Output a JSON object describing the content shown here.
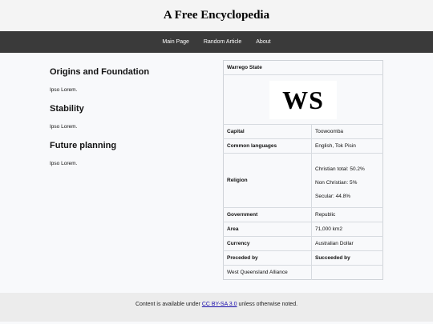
{
  "site": {
    "title": "A Free Encyclopedia"
  },
  "nav": {
    "items": [
      "Main Page",
      "Random Article",
      "About"
    ]
  },
  "article": {
    "sections": [
      {
        "heading": "Origins and Foundation",
        "body": "Ipso Lorem."
      },
      {
        "heading": "Stability",
        "body": "Ipso Lorem."
      },
      {
        "heading": "Future planning",
        "body": "Ipso Lorem."
      }
    ]
  },
  "infobox": {
    "title": "Warrego State",
    "logo_text": "WS",
    "capital_label": "Capital",
    "capital_value": "Toowoomba",
    "languages_label": "Common languages",
    "languages_value": "English, Tok Pisin",
    "religion_label": "Religion",
    "religion_values": [
      "Christian total: 50.2%",
      "Non Christian: 5%",
      "Secular: 44.8%"
    ],
    "government_label": "Government",
    "government_value": "Republic",
    "area_label": "Area",
    "area_value": "71,000 km2",
    "currency_label": "Currency",
    "currency_value": "Australian Dollar",
    "preceded_label": "Preceded by",
    "succeeded_label": "Succeeded by",
    "preceded_value": "West Queensland Alliance",
    "succeeded_value": ""
  },
  "footer": {
    "prefix": "Content is available under ",
    "license_link": "CC BY-SA 3.0",
    "suffix": " unless otherwise noted."
  }
}
